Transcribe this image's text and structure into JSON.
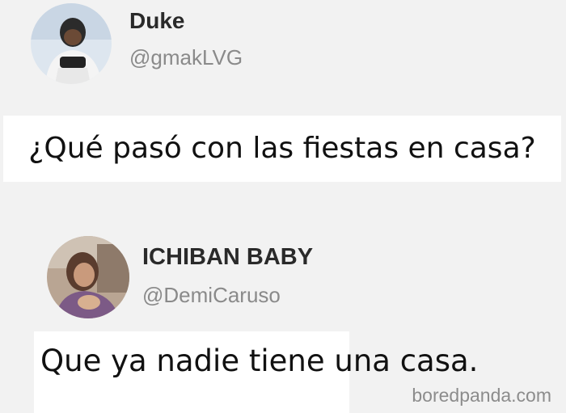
{
  "posts": [
    {
      "display_name": "Duke",
      "handle": "@gmakLVG",
      "text": "¿Qué pasó con las fiestas en casa?",
      "avatar_icon": "profile-photo-icon"
    },
    {
      "display_name": "ICHIBAN BABY",
      "handle": "@DemiCaruso",
      "text": "Que ya nadie tiene una casa.",
      "avatar_icon": "profile-photo-icon"
    }
  ],
  "watermark": "boredpanda.com",
  "colors": {
    "background": "#f2f2f2",
    "caption_background": "#ffffff",
    "name": "#2a2a2a",
    "handle": "#8a8a8a"
  }
}
